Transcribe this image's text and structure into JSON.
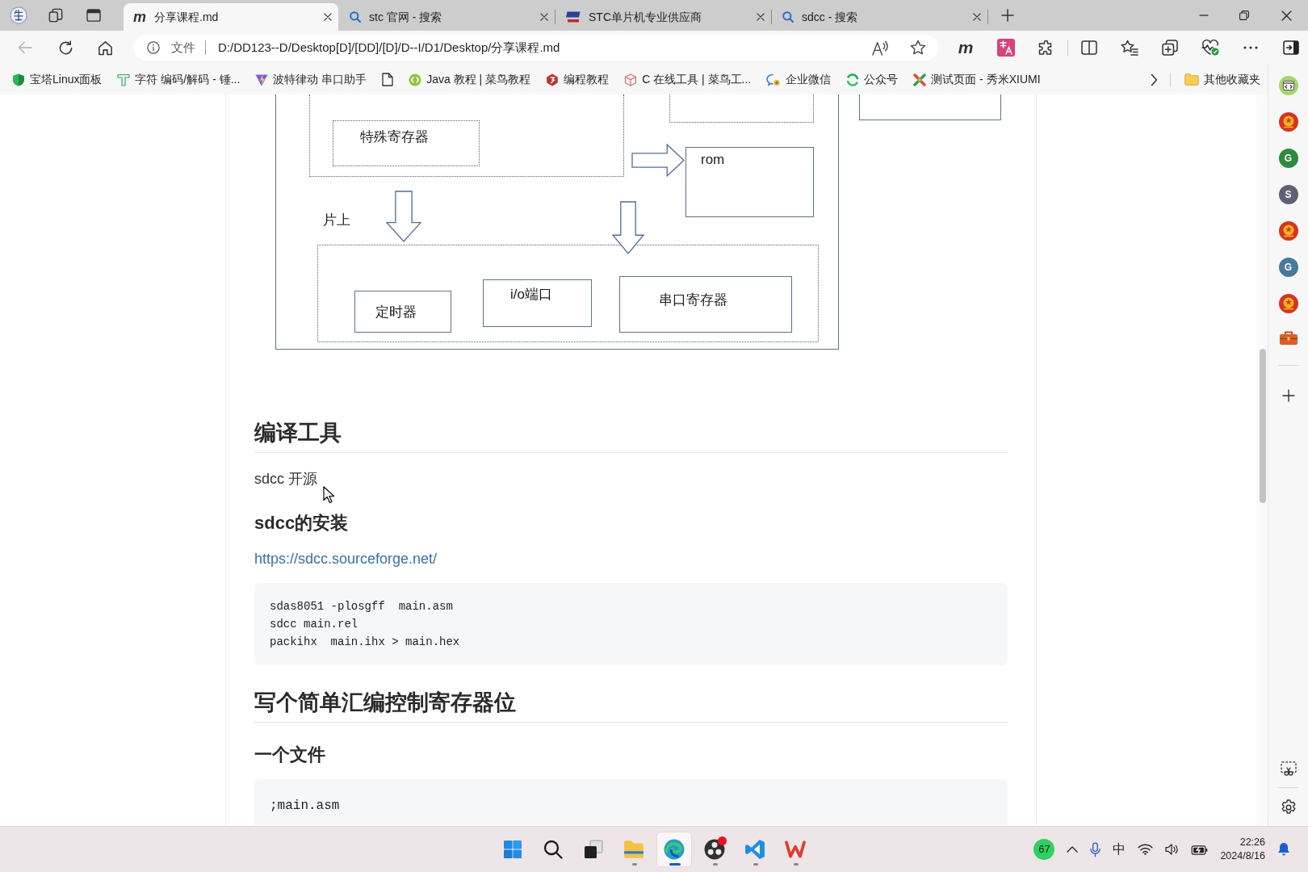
{
  "browser": {
    "tabs": [
      {
        "title": "分享课程.md",
        "kind": "letter",
        "icon_text": "m",
        "selected": true
      },
      {
        "title": "stc 官网 - 搜索",
        "kind": "search",
        "selected": false
      },
      {
        "title": "STC单片机专业供应商",
        "kind": "logo",
        "selected": false
      },
      {
        "title": "sdcc - 搜索",
        "kind": "search",
        "selected": false
      }
    ],
    "address_bar": {
      "back_disabled": true,
      "site_label": "文件",
      "url": "D:/DD123--D/Desktop[D]/[DD]/[D]/D--I/D1/Desktop/分享课程.md"
    },
    "toolbar": [
      {
        "kind": "letter",
        "text": "m"
      },
      {
        "kind": "translate"
      },
      {
        "kind": "extensions"
      },
      {
        "kind": "divider"
      },
      {
        "kind": "split"
      },
      {
        "kind": "favorites"
      },
      {
        "kind": "collections"
      },
      {
        "kind": "essentials"
      },
      {
        "kind": "more"
      },
      {
        "kind": "sidebar"
      }
    ],
    "bookmarks": [
      {
        "kind": "shield",
        "title": "宝塔Linux面板"
      },
      {
        "kind": "hammer",
        "title": "字符 编码/解码 - 锤..."
      },
      {
        "kind": "triangle",
        "title": "波特律动 串口助手"
      },
      {
        "kind": "file"
      },
      {
        "kind": "code",
        "title": "Java 教程 | 菜鸟教程"
      },
      {
        "kind": "hexagon",
        "title": "编程教程"
      },
      {
        "kind": "cube",
        "title": "C 在线工具 | 菜鸟工..."
      },
      {
        "kind": "chat",
        "title": "企业微信"
      },
      {
        "kind": "arrows",
        "title": "公众号"
      },
      {
        "kind": "cross",
        "title": "测试页面 - 秀米XIUMI"
      }
    ],
    "other_bookmarks": "其他收藏夹"
  },
  "document": {
    "diagram": {
      "boxes": [
        {
          "kind": "solid"
        },
        {
          "kind": "dotted"
        },
        {
          "kind": "dotted",
          "label": "特殊寄存器"
        },
        {
          "kind": "dotted"
        },
        {
          "kind": "solid"
        },
        {
          "kind": "solid",
          "label": "rom"
        },
        {
          "kind": "dotted"
        },
        {
          "kind": "solid",
          "label": "定时器"
        },
        {
          "kind": "solid",
          "label": "i/o端口"
        },
        {
          "kind": "solid",
          "label": "串口寄存器"
        }
      ],
      "labels": [
        "片上"
      ],
      "arrows": [
        {
          "kind": "right"
        },
        {
          "kind": "down"
        },
        {
          "kind": "down"
        }
      ]
    },
    "blocks": [
      {
        "kind": "h2",
        "text": "编译工具"
      },
      {
        "kind": "p",
        "text": "sdcc 开源"
      },
      {
        "kind": "h3",
        "text": "sdcc的安装"
      },
      {
        "kind": "link",
        "text": "https://sdcc.sourceforge.net/"
      },
      {
        "kind": "code",
        "lines": [
          "sdas8051 -plosgff  main.asm",
          "sdcc main.rel",
          "packihx  main.ihx > main.hex"
        ]
      },
      {
        "kind": "h2",
        "text": "写个简单汇编控制寄存器位"
      },
      {
        "kind": "h3",
        "text": "一个文件"
      },
      {
        "kind": "code",
        "lines": [
          ";main.asm"
        ]
      }
    ]
  },
  "sidebar": {
    "items": [
      {
        "kind": "code"
      },
      {
        "kind": "emblem"
      },
      {
        "kind": "letter",
        "text": "G",
        "color": "#2e8b3e"
      },
      {
        "kind": "letter",
        "text": "S",
        "color": "#5f6072"
      },
      {
        "kind": "emblem"
      },
      {
        "kind": "letter",
        "text": "G",
        "color": "#4a7a9b"
      },
      {
        "kind": "emblem"
      },
      {
        "kind": "toolbox"
      },
      {
        "kind": "divider"
      },
      {
        "kind": "add"
      }
    ],
    "bottom": [
      {
        "kind": "screenshot"
      },
      {
        "kind": "divider"
      },
      {
        "kind": "settings"
      }
    ]
  },
  "taskbar": {
    "apps": [
      {
        "kind": "start",
        "running": false,
        "selected": false,
        "notification": false
      },
      {
        "kind": "search",
        "running": false,
        "selected": false,
        "notification": false
      },
      {
        "kind": "taskview",
        "running": false,
        "selected": false,
        "notification": false
      },
      {
        "kind": "explorer",
        "running": true,
        "selected": false,
        "notification": false
      },
      {
        "kind": "browser",
        "running": true,
        "selected": true,
        "notification": false
      },
      {
        "kind": "recorder",
        "running": true,
        "selected": false,
        "notification": true
      },
      {
        "kind": "editor",
        "running": true,
        "selected": false,
        "notification": false
      },
      {
        "kind": "office",
        "running": true,
        "selected": false,
        "notification": false
      }
    ],
    "tray": [
      {
        "kind": "badge",
        "text": "67"
      },
      {
        "kind": "overflow"
      },
      {
        "kind": "mic"
      },
      {
        "kind": "ime",
        "text": "中"
      },
      {
        "kind": "wifi"
      },
      {
        "kind": "volume"
      },
      {
        "kind": "battery"
      },
      {
        "kind": "clock",
        "time": "22:26",
        "date": "2024/8/16"
      },
      {
        "kind": "notifications"
      }
    ]
  }
}
